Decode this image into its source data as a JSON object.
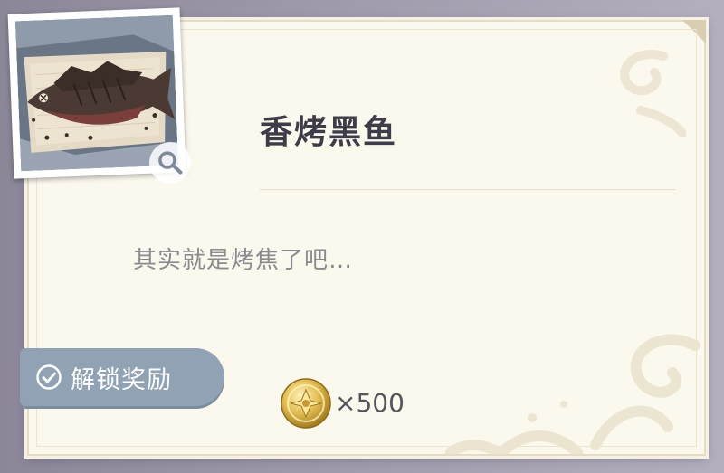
{
  "item": {
    "name": "香烤黑鱼",
    "description": "其实就是烤焦了吧…",
    "image_icon": "burnt-grilled-fish-on-plate"
  },
  "reward": {
    "badge_label": "解锁奖励",
    "badge_icon": "check-circle-icon",
    "currency_icon": "gold-coin-icon",
    "amount": "×500"
  },
  "colors": {
    "card_bg": "#fbf8ee",
    "title": "#3e3c48",
    "description": "#8a8a8f",
    "badge_bg": "#90a2b3",
    "coin_gold": "#d9b24a"
  }
}
